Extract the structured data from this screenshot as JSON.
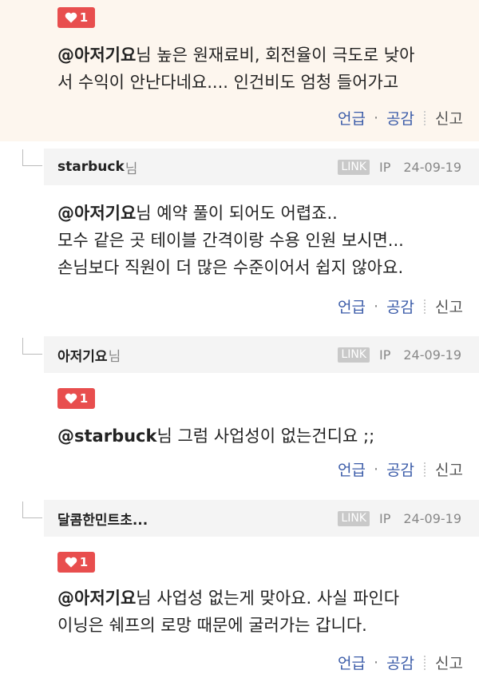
{
  "colors": {
    "accent_red": "#e84e4e",
    "link_blue": "#3a5ba8",
    "highlight_bg": "#fdf6ee"
  },
  "icons": {
    "like": "heart-icon"
  },
  "action_labels": {
    "reply": "언급",
    "sep": "·",
    "like": "공감",
    "report": "신고"
  },
  "comments": [
    {
      "likes": "1",
      "mention": "@아저기요",
      "body_lines": [
        "님 높은 원재료비, 회전율이 극도로 낮아",
        "서 수익이 안난다네요.... 인건비도 엄청 들어가고"
      ]
    },
    {
      "nickname": "starbuck",
      "suffix": "님",
      "link_badge": "LINK",
      "ip": "IP",
      "date": "24-09-19",
      "mention": "@아저기요",
      "body_lines": [
        "님 예약 풀이 되어도 어렵죠..",
        "모수 같은 곳 테이블 간격이랑 수용 인원 보시면...",
        "손님보다 직원이 더 많은 수준이어서 쉽지 않아요."
      ]
    },
    {
      "nickname": "아저기요",
      "suffix": "님",
      "link_badge": "LINK",
      "ip": "IP",
      "date": "24-09-19",
      "likes": "1",
      "mention": "@starbuck",
      "body_lines": [
        "님 그럼 사업성이 없는건디요 ;;"
      ]
    },
    {
      "nickname": "달콤한민트초...",
      "link_badge": "LINK",
      "ip": "IP",
      "date": "24-09-19",
      "likes": "1",
      "mention": "@아저기요",
      "body_lines": [
        "님 사업성 없는게 맞아요. 사실 파인다",
        "이닝은 쉐프의 로망 때문에 굴러가는 갑니다."
      ]
    }
  ]
}
